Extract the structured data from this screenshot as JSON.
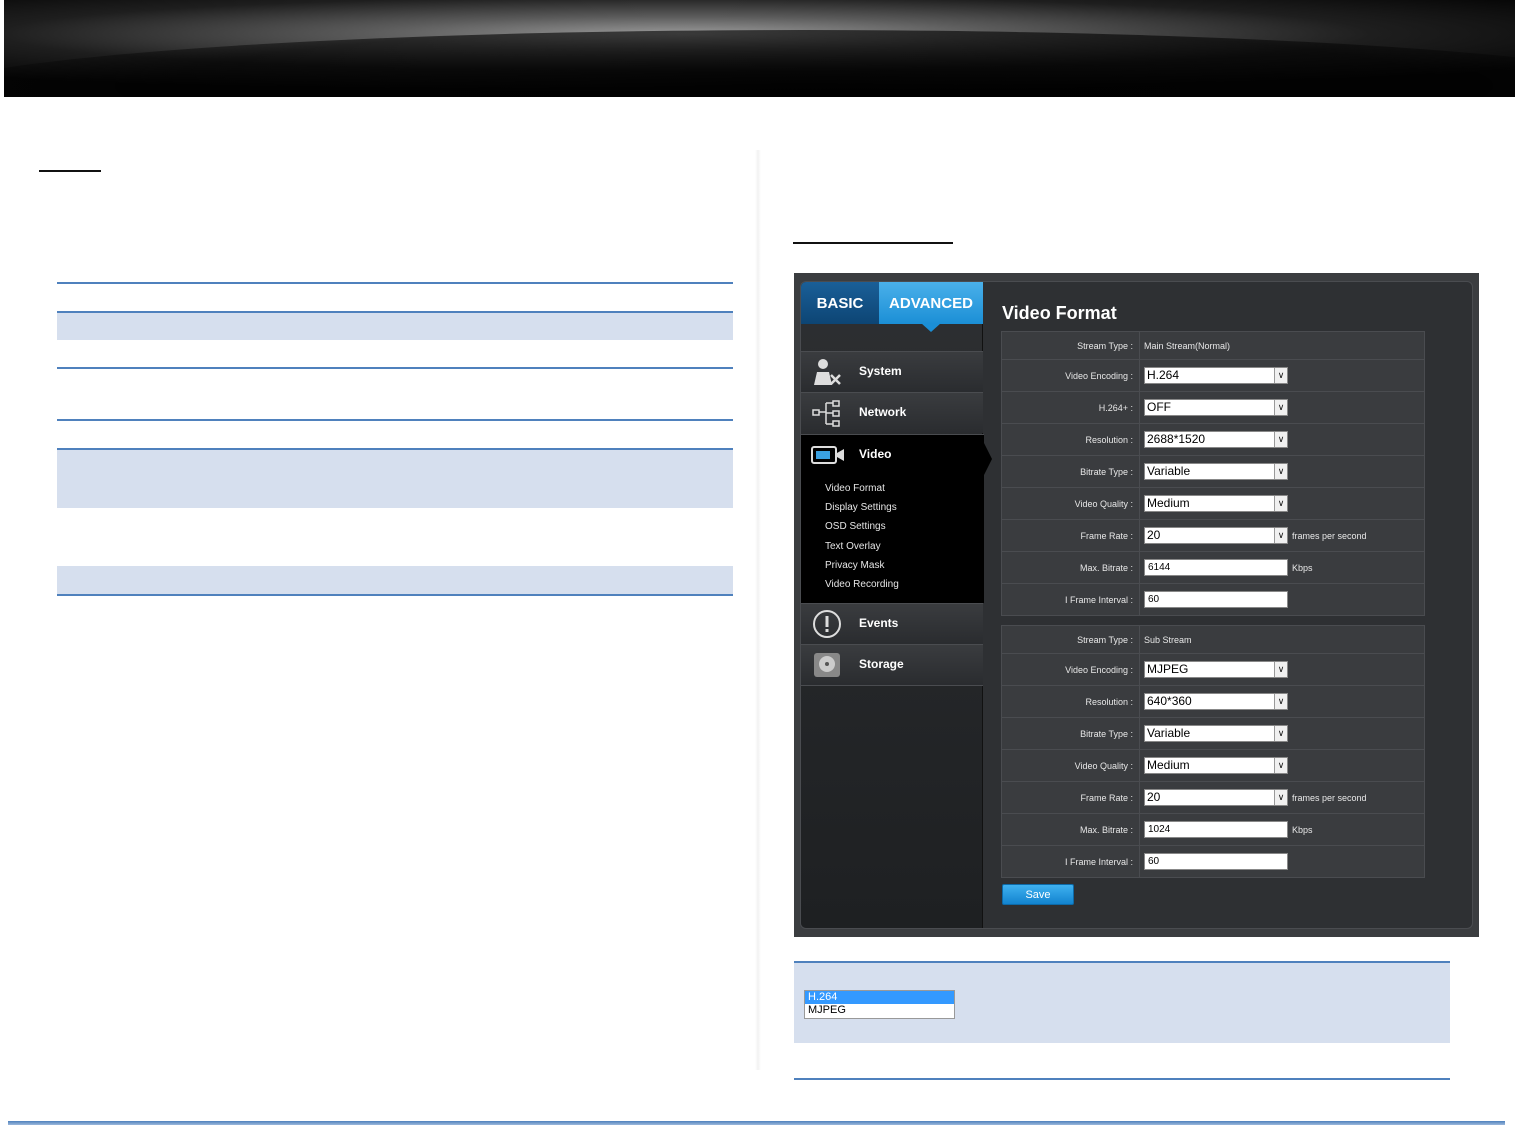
{
  "camera_ui": {
    "tabs": {
      "basic": "BASIC",
      "advanced": "ADVANCED"
    },
    "nav": {
      "system": "System",
      "network": "Network",
      "video": "Video",
      "video_sub": [
        "Video Format",
        "Display Settings",
        "OSD Settings",
        "Text Overlay",
        "Privacy Mask",
        "Video Recording"
      ],
      "events": "Events",
      "storage": "Storage"
    },
    "title": "Video Format",
    "main_stream": {
      "stream_type_label": "Stream Type :",
      "stream_type_value": "Main Stream(Normal)",
      "video_encoding_label": "Video Encoding :",
      "video_encoding_value": "H.264",
      "h264plus_label": "H.264+ :",
      "h264plus_value": "OFF",
      "resolution_label": "Resolution :",
      "resolution_value": "2688*1520",
      "bitrate_type_label": "Bitrate Type :",
      "bitrate_type_value": "Variable",
      "video_quality_label": "Video Quality :",
      "video_quality_value": "Medium",
      "frame_rate_label": "Frame Rate :",
      "frame_rate_value": "20",
      "frame_rate_unit": "frames per second",
      "max_bitrate_label": "Max. Bitrate :",
      "max_bitrate_value": "6144",
      "max_bitrate_unit": "Kbps",
      "iframe_label": "I Frame Interval :",
      "iframe_value": "60"
    },
    "sub_stream": {
      "stream_type_label": "Stream Type :",
      "stream_type_value": "Sub Stream",
      "video_encoding_label": "Video Encoding :",
      "video_encoding_value": "MJPEG",
      "resolution_label": "Resolution :",
      "resolution_value": "640*360",
      "bitrate_type_label": "Bitrate Type :",
      "bitrate_type_value": "Variable",
      "video_quality_label": "Video Quality :",
      "video_quality_value": "Medium",
      "frame_rate_label": "Frame Rate :",
      "frame_rate_value": "20",
      "frame_rate_unit": "frames per second",
      "max_bitrate_label": "Max. Bitrate :",
      "max_bitrate_value": "1024",
      "max_bitrate_unit": "Kbps",
      "iframe_label": "I Frame Interval :",
      "iframe_value": "60"
    },
    "save_label": "Save"
  },
  "encoding_list": {
    "options": [
      "H.264",
      "MJPEG"
    ],
    "selected": "H.264"
  },
  "colors": {
    "accent_blue": "#4f81bd",
    "band": "#d6dfee",
    "selected_option": "#3399ff"
  }
}
